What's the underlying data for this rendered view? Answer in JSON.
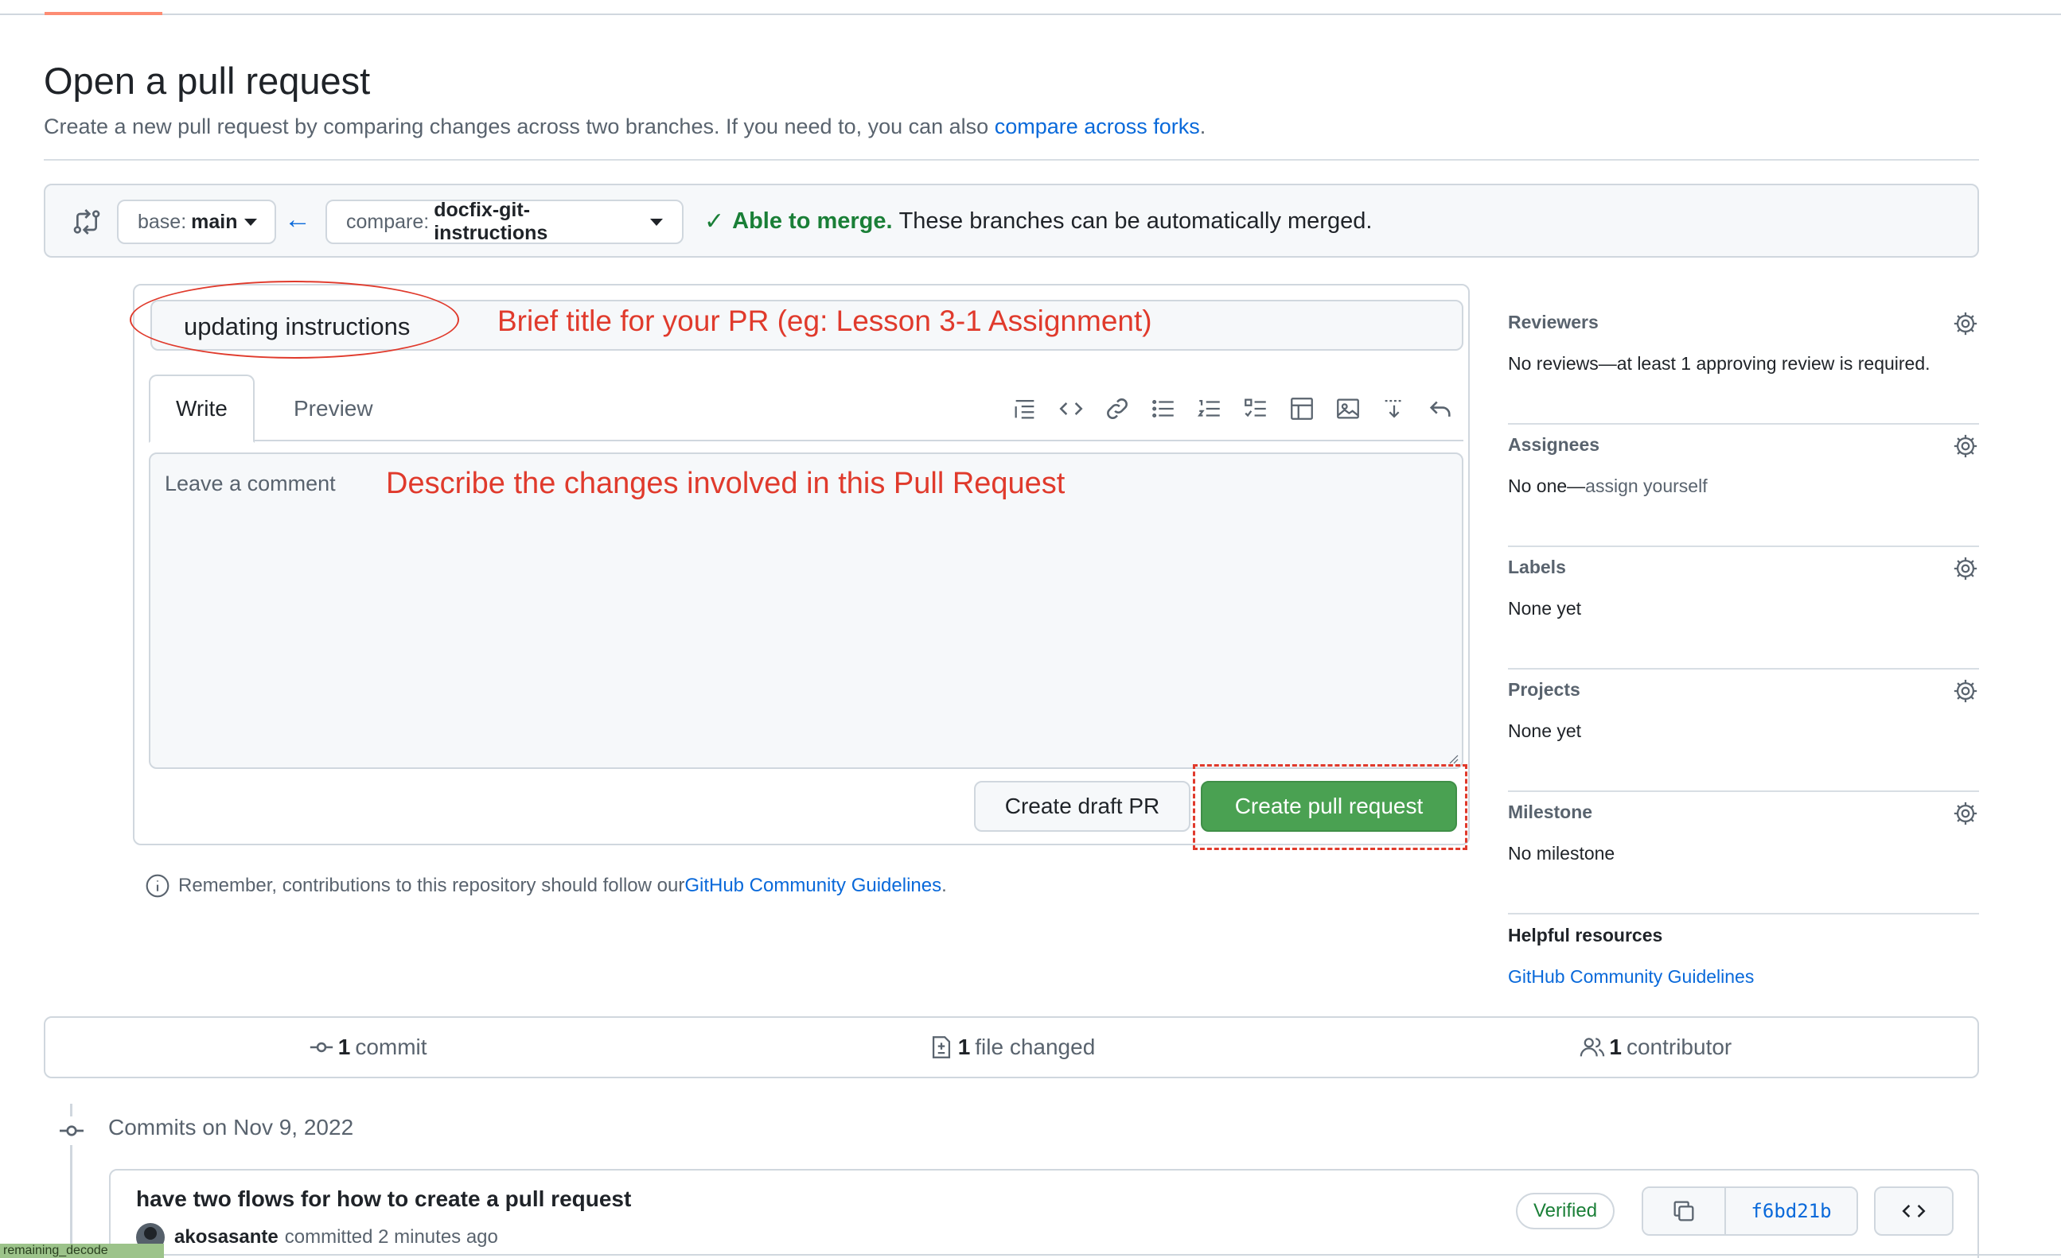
{
  "page": {
    "title": "Open a pull request",
    "description": "Create a new pull request by comparing changes across two branches. If you need to, you can also ",
    "description_link": "compare across forks",
    "description_end": "."
  },
  "compare": {
    "base_prefix": "base:",
    "base_value": "main",
    "compare_prefix": "compare:",
    "compare_value": "docfix-git-instructions",
    "merge_ok": "Able to merge.",
    "merge_text": "These branches can be automatically merged."
  },
  "form": {
    "title_value": "updating instructions",
    "title_annotation": "Brief title for your PR (eg: Lesson 3-1 Assignment)",
    "tab_write": "Write",
    "tab_preview": "Preview",
    "comment_placeholder": "Leave a comment",
    "comment_annotation": "Describe the changes involved in this Pull Request",
    "draft_button": "Create draft PR",
    "create_button": "Create pull request"
  },
  "toolbar_icons": [
    "heading-icon",
    "code-icon",
    "link-icon",
    "unordered-list-icon",
    "ordered-list-icon",
    "task-list-icon",
    "table-icon",
    "image-icon",
    "mention-icon",
    "undo-icon"
  ],
  "remember": {
    "text": "Remember, contributions to this repository should follow our ",
    "link": "GitHub Community Guidelines",
    "end": "."
  },
  "sidebar": {
    "sections": [
      {
        "heading": "Reviewers",
        "value": "No reviews—at least 1 approving review is required."
      },
      {
        "heading": "Assignees",
        "value": "No one—",
        "link": "assign yourself"
      },
      {
        "heading": "Labels",
        "value": "None yet"
      },
      {
        "heading": "Projects",
        "value": "None yet"
      },
      {
        "heading": "Milestone",
        "value": "No milestone"
      }
    ],
    "help_heading": "Helpful resources",
    "help_link": "GitHub Community Guidelines"
  },
  "stats": {
    "commits_count": "1",
    "commits_label": "commit",
    "files_count": "1",
    "files_label": "file changed",
    "contributors_count": "1",
    "contributors_label": "contributor"
  },
  "commits": {
    "date_heading": "Commits on Nov 9, 2022",
    "items": [
      {
        "message": "have two flows for how to create a pull request",
        "author": "akosasante",
        "meta": "committed 2 minutes ago",
        "verified": "Verified",
        "sha": "f6bd21b"
      }
    ]
  },
  "bottom_tag": "remaining_decode"
}
